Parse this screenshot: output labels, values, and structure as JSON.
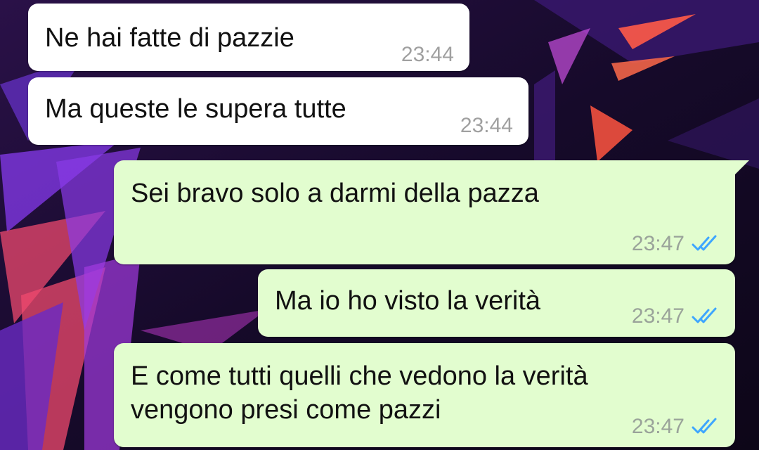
{
  "colors": {
    "incoming_bubble": "#ffffff",
    "outgoing_bubble": "#e2fdcf",
    "read_ticks": "#3ea6ff",
    "timestamp": "#9aa39a"
  },
  "messages": [
    {
      "direction": "incoming",
      "text": "Ne hai fatte di pazzie",
      "time": "23:44"
    },
    {
      "direction": "incoming",
      "text": "Ma queste le supera tutte",
      "time": "23:44"
    },
    {
      "direction": "outgoing",
      "text": "Sei bravo solo a darmi della pazza",
      "time": "23:47",
      "status": "read",
      "status_icon": "double-check-icon"
    },
    {
      "direction": "outgoing",
      "text": "Ma io ho visto la verità",
      "time": "23:47",
      "status": "read",
      "status_icon": "double-check-icon"
    },
    {
      "direction": "outgoing",
      "text": "E come tutti quelli che vedono la verità",
      "text_line2": "vengono presi come pazzi",
      "time": "23:47",
      "status": "read",
      "status_icon": "double-check-icon"
    }
  ]
}
